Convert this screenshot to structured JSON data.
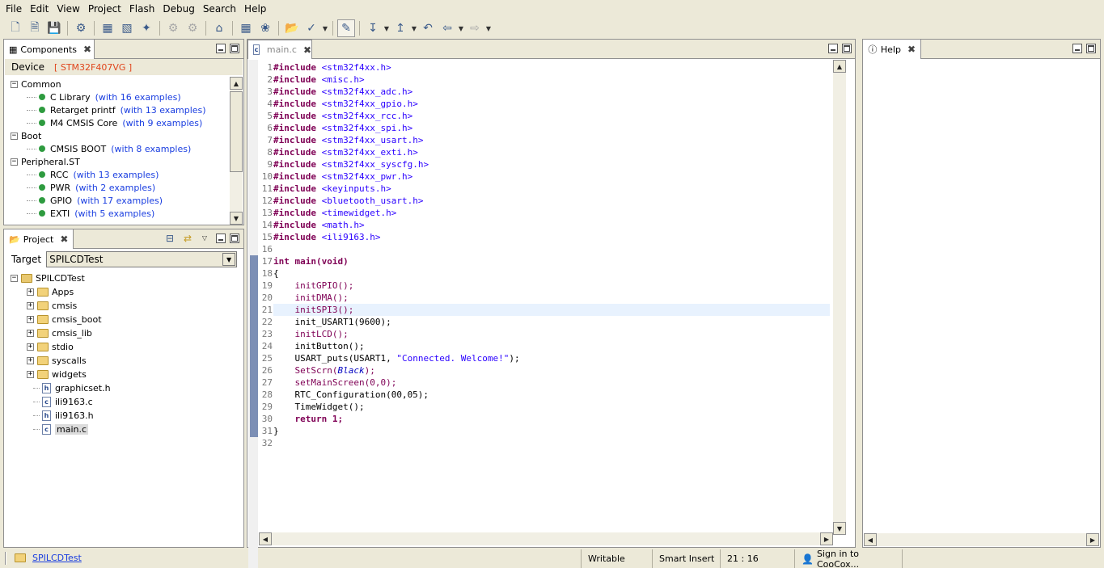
{
  "menu": [
    "File",
    "Edit",
    "View",
    "Project",
    "Flash",
    "Debug",
    "Search",
    "Help"
  ],
  "toolbar": {
    "icons": [
      "new-file-icon",
      "new-page-icon",
      "save-icon",
      "build-icon",
      "rebuild-icon",
      "download-icon",
      "flash-icon",
      "debug-settings-icon",
      "settings-icon",
      "home-icon",
      "components-icon",
      "repository-icon",
      "open-project-icon",
      "configure-icon",
      "highlight-icon",
      "bookmark-down-icon",
      "bookmark-up-icon",
      "nav-last-edit-icon",
      "nav-back-icon",
      "nav-forward-icon"
    ]
  },
  "components": {
    "tab_label": "Components",
    "device_label": "Device",
    "device_value": "[ STM32F407VG ]",
    "groups": [
      {
        "name": "Common",
        "items": [
          {
            "name": "C Library",
            "examples": "(with 16 examples)"
          },
          {
            "name": "Retarget printf",
            "examples": "(with 13 examples)"
          },
          {
            "name": "M4 CMSIS Core",
            "examples": "(with 9 examples)"
          }
        ]
      },
      {
        "name": "Boot",
        "items": [
          {
            "name": "CMSIS BOOT",
            "examples": "(with 8 examples)"
          }
        ]
      },
      {
        "name": "Peripheral.ST",
        "items": [
          {
            "name": "RCC",
            "examples": "(with 13 examples)"
          },
          {
            "name": "PWR",
            "examples": "(with 2 examples)"
          },
          {
            "name": "GPIO",
            "examples": "(with 17 examples)"
          },
          {
            "name": "EXTI",
            "examples": "(with 5 examples)"
          }
        ]
      }
    ]
  },
  "project": {
    "tab_label": "Project",
    "target_label": "Target",
    "target_value": "SPILCDTest",
    "root": "SPILCDTest",
    "folders": [
      "Apps",
      "cmsis",
      "cmsis_boot",
      "cmsis_lib",
      "stdio",
      "syscalls",
      "widgets"
    ],
    "files": [
      "graphicset.h",
      "ili9163.c",
      "ili9163.h",
      "main.c"
    ]
  },
  "editor": {
    "tab_label": "main.c",
    "lines": [
      {
        "n": "1",
        "kind": "include",
        "text": "<stm32f4xx.h>"
      },
      {
        "n": "2",
        "kind": "include",
        "text": "<misc.h>"
      },
      {
        "n": "3",
        "kind": "include",
        "text": "<stm32f4xx_adc.h>"
      },
      {
        "n": "4",
        "kind": "include",
        "text": "<stm32f4xx_gpio.h>"
      },
      {
        "n": "5",
        "kind": "include",
        "text": "<stm32f4xx_rcc.h>"
      },
      {
        "n": "6",
        "kind": "include",
        "text": "<stm32f4xx_spi.h>"
      },
      {
        "n": "7",
        "kind": "include",
        "text": "<stm32f4xx_usart.h>"
      },
      {
        "n": "8",
        "kind": "include",
        "text": "<stm32f4xx_exti.h>"
      },
      {
        "n": "9",
        "kind": "include",
        "text": "<stm32f4xx_syscfg.h>"
      },
      {
        "n": "10",
        "kind": "include",
        "text": "<stm32f4xx_pwr.h>"
      },
      {
        "n": "11",
        "kind": "include",
        "text": "<keyinputs.h>"
      },
      {
        "n": "12",
        "kind": "include",
        "text": "<bluetooth_usart.h>"
      },
      {
        "n": "13",
        "kind": "include",
        "text": "<timewidget.h>"
      },
      {
        "n": "14",
        "kind": "include",
        "text": "<math.h>"
      },
      {
        "n": "15",
        "kind": "include",
        "text": "<ili9163.h>"
      },
      {
        "n": "16",
        "kind": "blank",
        "text": ""
      },
      {
        "n": "17",
        "kind": "main",
        "text": "int main(void)"
      },
      {
        "n": "18",
        "kind": "plain",
        "text": "{"
      },
      {
        "n": "19",
        "kind": "call",
        "text": "    initGPIO();"
      },
      {
        "n": "20",
        "kind": "call",
        "text": "    initDMA();"
      },
      {
        "n": "21",
        "kind": "call",
        "text": "    initSPI3();"
      },
      {
        "n": "22",
        "kind": "plain",
        "text": "    init_USART1(9600);"
      },
      {
        "n": "23",
        "kind": "call",
        "text": "    initLCD();"
      },
      {
        "n": "24",
        "kind": "plain",
        "text": "    initButton();"
      },
      {
        "n": "25",
        "kind": "puts",
        "text": "    USART_puts(USART1, ",
        "str": "\"Connected. Welcome!\"",
        "tail": ");"
      },
      {
        "n": "26",
        "kind": "scrn",
        "text": "    SetScrn(",
        "arg": "Black",
        "tail": ");"
      },
      {
        "n": "27",
        "kind": "call",
        "text": "    setMainScreen(0,0);"
      },
      {
        "n": "28",
        "kind": "plain",
        "text": "    RTC_Configuration(00,05);"
      },
      {
        "n": "29",
        "kind": "plain",
        "text": "    TimeWidget();"
      },
      {
        "n": "30",
        "kind": "return",
        "text": "    return 1;"
      },
      {
        "n": "31",
        "kind": "plain",
        "text": "}"
      },
      {
        "n": "32",
        "kind": "blank",
        "text": ""
      }
    ]
  },
  "help": {
    "tab_label": "Help"
  },
  "status": {
    "project": "SPILCDTest",
    "writable": "Writable",
    "insert_mode": "Smart Insert",
    "position": "21 : 16",
    "sign_in": "Sign in to CooCox..."
  }
}
